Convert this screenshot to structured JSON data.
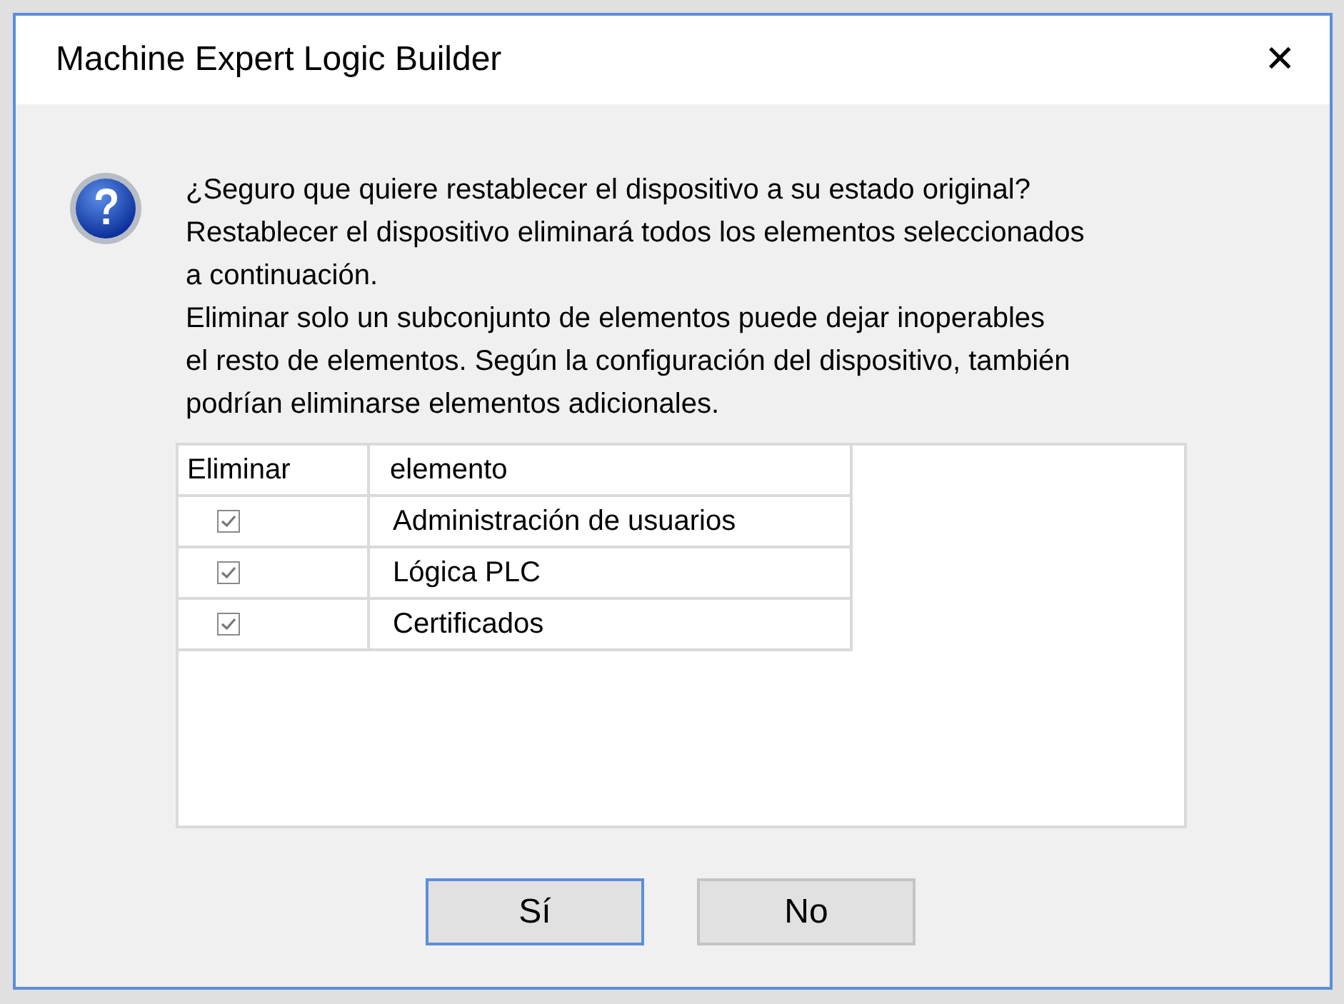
{
  "window": {
    "title": "Machine Expert Logic Builder",
    "close": "✕"
  },
  "message_lines": [
    "¿Seguro que quiere restablecer el dispositivo a su estado original?",
    "Restablecer el dispositivo eliminará todos los elementos seleccionados",
    "a continuación.",
    "Eliminar solo un subconjunto de elementos puede dejar inoperables",
    "el resto de elementos. Según la configuración del dispositivo, también",
    "podrían eliminarse elementos adicionales."
  ],
  "table": {
    "columns": [
      "Eliminar",
      "elemento"
    ],
    "rows": [
      {
        "checked": true,
        "item": "Administración de usuarios"
      },
      {
        "checked": true,
        "item": "Lógica PLC"
      },
      {
        "checked": true,
        "item": "Certificados"
      }
    ]
  },
  "buttons": [
    {
      "label": "Sí",
      "default": true
    },
    {
      "label": "No",
      "default": false
    }
  ]
}
